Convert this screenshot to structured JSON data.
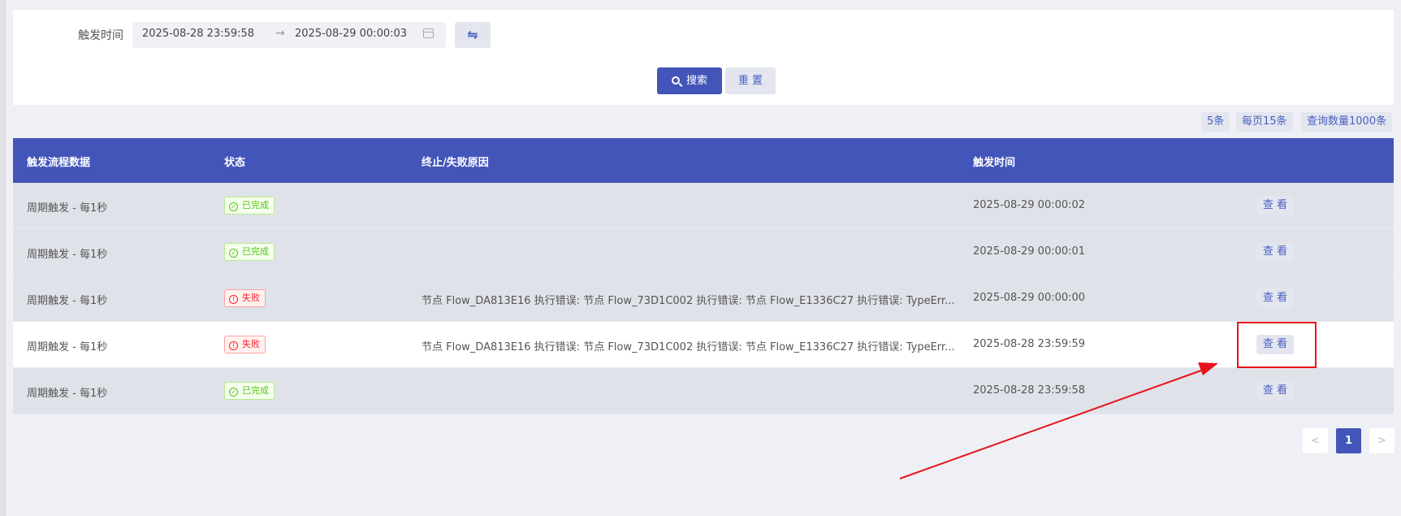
{
  "filter": {
    "label": "触发时间",
    "start_date": "2025-08-28 23:59:58",
    "range_separator": "→",
    "end_date": "2025-08-29 00:00:03",
    "swap_glyph": "⇋"
  },
  "buttons": {
    "search_label": "搜索",
    "reset_label": "重 置"
  },
  "summary_tags": [
    "5条",
    "每页15条",
    "查询数量1000条"
  ],
  "table": {
    "columns": [
      "触发流程数据",
      "状态",
      "终止/失败原因",
      "触发时间"
    ],
    "rows": [
      {
        "data": "周期触发 - 每1秒",
        "status": "已完成",
        "status_icon": "✓",
        "reason": "",
        "time": "2025-08-29 00:00:02",
        "action": "查 看"
      },
      {
        "data": "周期触发 - 每1秒",
        "status": "已完成",
        "status_icon": "✓",
        "reason": "",
        "time": "2025-08-29 00:00:01",
        "action": "查 看"
      },
      {
        "data": "周期触发 - 每1秒",
        "status": "失败",
        "status_icon": "!",
        "reason": "节点 Flow_DA813E16 执行错误: 节点 Flow_73D1C002 执行错误: 节点 Flow_E1336C27 执行错误: TypeErr...",
        "time": "2025-08-29 00:00:00",
        "action": "查 看"
      },
      {
        "data": "周期触发 - 每1秒",
        "status": "失败",
        "status_icon": "!",
        "reason": "节点 Flow_DA813E16 执行错误: 节点 Flow_73D1C002 执行错误: 节点 Flow_E1336C27 执行错误: TypeErr...",
        "time": "2025-08-28 23:59:59",
        "action": "查 看"
      },
      {
        "data": "周期触发 - 每1秒",
        "status": "已完成",
        "status_icon": "✓",
        "reason": "",
        "time": "2025-08-28 23:59:58",
        "action": "查 看"
      }
    ]
  },
  "pagination": {
    "prev": "<",
    "current": "1",
    "next": ">"
  },
  "colors": {
    "primary": "#4355b9",
    "success": "#52c41a",
    "error": "#f5222d",
    "annotation": "#e8141c"
  }
}
